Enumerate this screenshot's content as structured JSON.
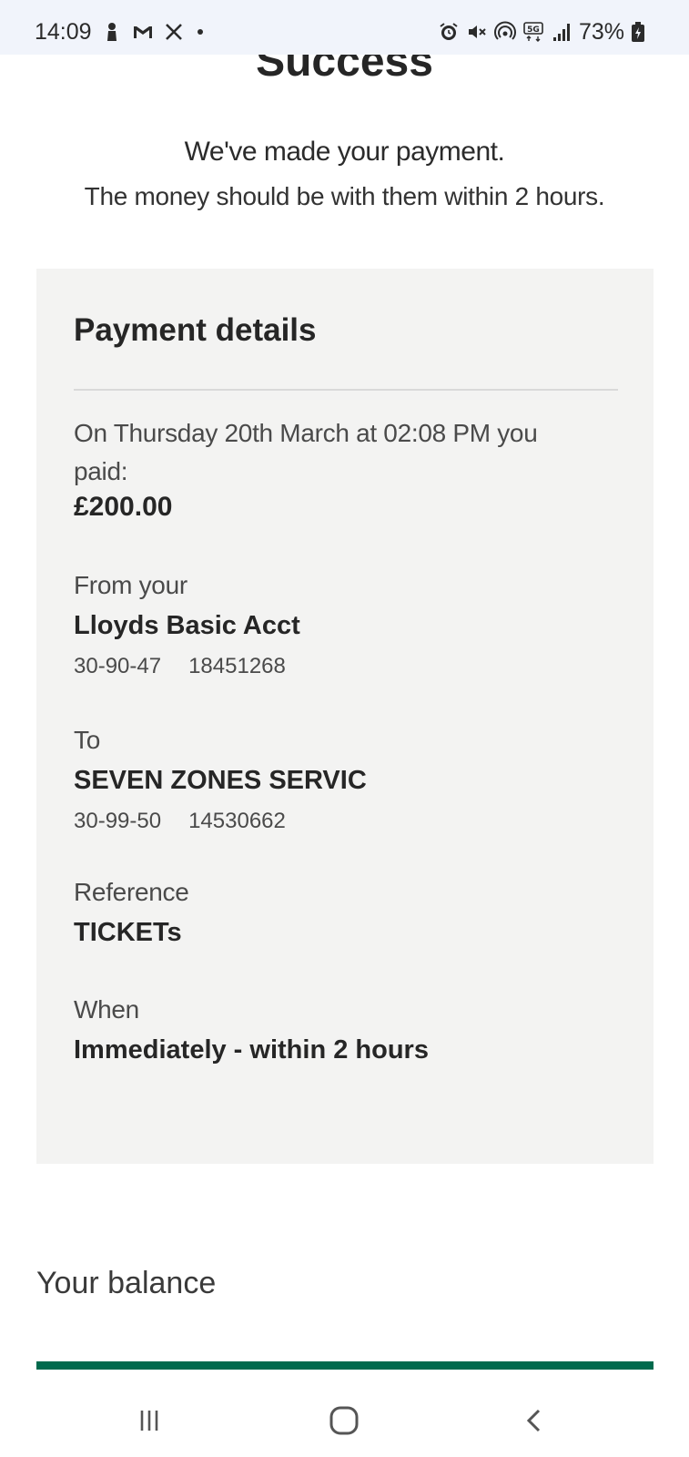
{
  "status_bar": {
    "time": "14:09",
    "battery": "73%",
    "network": "5G",
    "left_icons": [
      "person-icon",
      "gmail-icon",
      "tools-icon"
    ],
    "right_icons": [
      "alarm-icon",
      "mute-icon",
      "hotspot-icon",
      "5g-icon",
      "signal-icon",
      "battery-charging-icon"
    ]
  },
  "header": {
    "title": "Success",
    "message": "We've made your payment.",
    "sub_message": "The money should be with them within 2 hours."
  },
  "payment_details": {
    "title": "Payment details",
    "paid_text": "On Thursday 20th March at 02:08 PM you paid:",
    "amount": "£200.00",
    "from_label": "From your",
    "from_account": "Lloyds Basic Acct",
    "from_sort_code": "30-90-47",
    "from_account_number": "18451268",
    "to_label": "To",
    "to_name": "SEVEN ZONES SERVIC",
    "to_sort_code": "30-99-50",
    "to_account_number": "14530662",
    "reference_label": "Reference",
    "reference": "TICKETs",
    "when_label": "When",
    "when": "Immediately - within 2 hours"
  },
  "balance": {
    "label": "Your balance"
  },
  "nav": {
    "recent_icon": "recent-apps-icon",
    "home_icon": "home-icon",
    "back_icon": "back-icon"
  },
  "colors": {
    "accent": "#006a4d",
    "card_background": "#f3f3f2",
    "status_bar_background": "#f1f4fb"
  }
}
